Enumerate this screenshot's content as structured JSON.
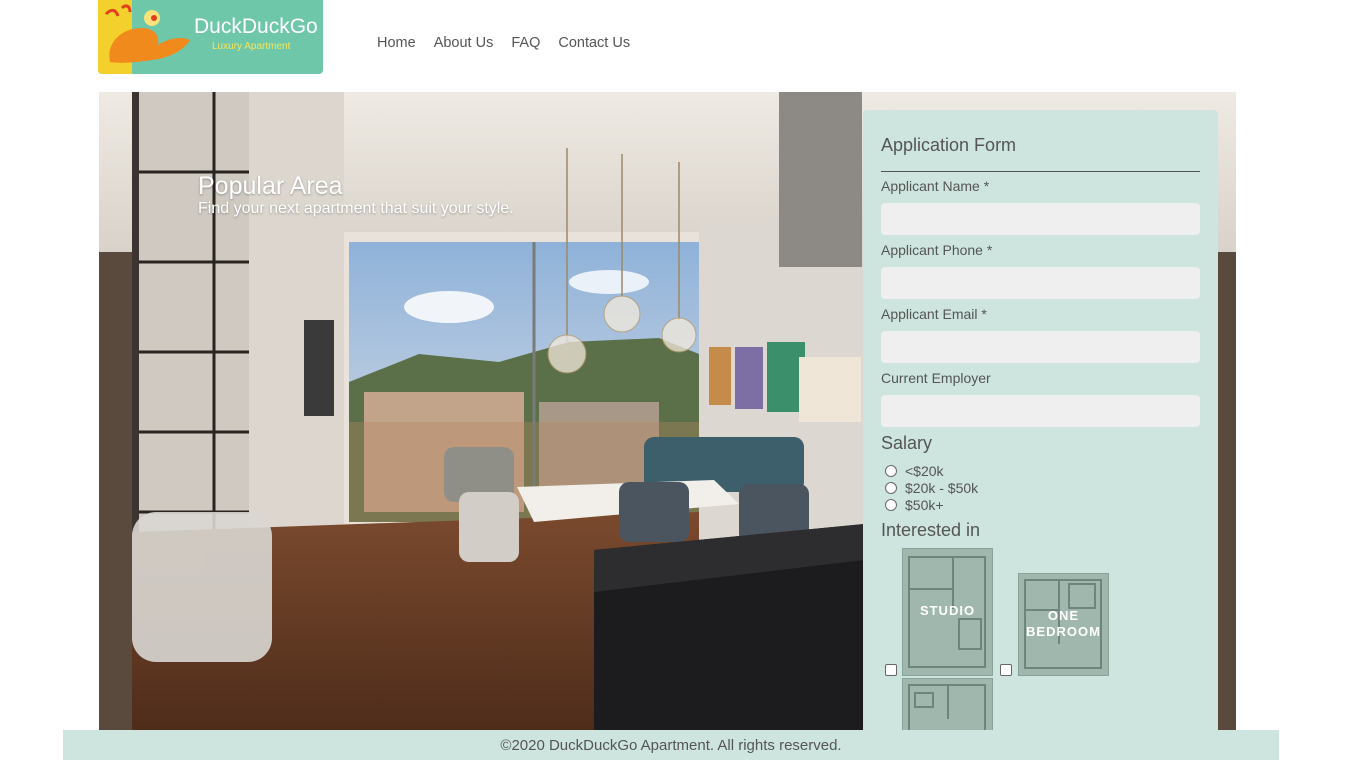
{
  "logo": {
    "brand": "DuckDuckGo",
    "tagline": "Luxury Apartment"
  },
  "nav": {
    "items": [
      "Home",
      "About Us",
      "FAQ",
      "Contact Us"
    ]
  },
  "hero": {
    "title": "Popular Area",
    "subtitle": "Find your next apartment that suit your style."
  },
  "form": {
    "title": "Application Form",
    "fields": {
      "name_label": "Applicant Name *",
      "phone_label": "Applicant Phone *",
      "email_label": "Applicant Email *",
      "employer_label": "Current Employer"
    },
    "salary": {
      "heading": "Salary",
      "options": [
        "<$20k",
        "$20k - $50k",
        "$50k+"
      ]
    },
    "interest": {
      "heading": "Interested in",
      "plans": [
        "STUDIO",
        "ONE BEDROOM"
      ]
    }
  },
  "footer": {
    "text": "©2020 DuckDuckGo Apartment. All rights reserved."
  },
  "colors": {
    "form_bg": "#cde5de",
    "logo_bg": "#6fc7aa",
    "logo_yellow": "#f4d02c",
    "text": "#555555"
  }
}
